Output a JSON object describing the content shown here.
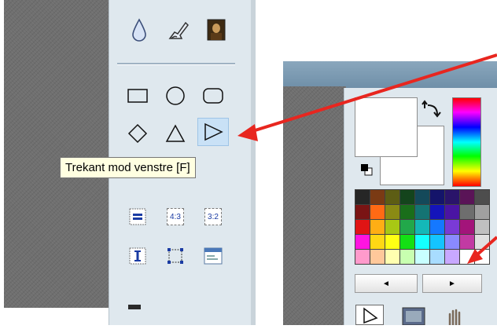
{
  "tooltip": {
    "text": "Trekant mod venstre [F]"
  },
  "icons": {
    "top_row": [
      "drop-icon",
      "smudge-brush-icon",
      "image-icon"
    ],
    "shapes_row1": [
      "rectangle-icon",
      "ellipse-icon",
      "rounded-rectangle-icon"
    ],
    "shapes_row2": [
      "diamond-icon",
      "triangle-up-icon",
      "triangle-left-icon"
    ],
    "ratio_row": [
      "equal-aspect-icon",
      "ratio-4-3-icon",
      "ratio-3-2-icon"
    ],
    "bottom_row": [
      "text-cursor-icon",
      "crop-selection-icon",
      "window-icon"
    ]
  },
  "ratio_labels": {
    "four_three": "4:3",
    "three_two": "3:2"
  },
  "palette": {
    "colors": [
      "#262626",
      "#7a3a14",
      "#5d5d14",
      "#14441c",
      "#14495a",
      "#14146a",
      "#2a146a",
      "#5a1457",
      "#4d4d4d",
      "#7a1414",
      "#ff6a14",
      "#8a8a14",
      "#1a6e1a",
      "#147373",
      "#1414ba",
      "#4a14a3",
      "#6e6e6e",
      "#a0a0a0",
      "#e01414",
      "#ffae14",
      "#a8c814",
      "#22a84a",
      "#14b8b8",
      "#1478ff",
      "#7a3ad6",
      "#a3147a",
      "#c0c0c0",
      "#ff14e0",
      "#ffd814",
      "#ffff14",
      "#14e014",
      "#14ffff",
      "#14c4ff",
      "#8a8aff",
      "#c23aa3",
      "#e0e0e0",
      "#ff9acc",
      "#ffc89a",
      "#ffffb0",
      "#c8ffb0",
      "#c8ffff",
      "#a8dcff",
      "#c8a8ff",
      "#ffffff",
      "#ffffff"
    ]
  },
  "nav": {
    "prev": "◄",
    "next": "►"
  }
}
